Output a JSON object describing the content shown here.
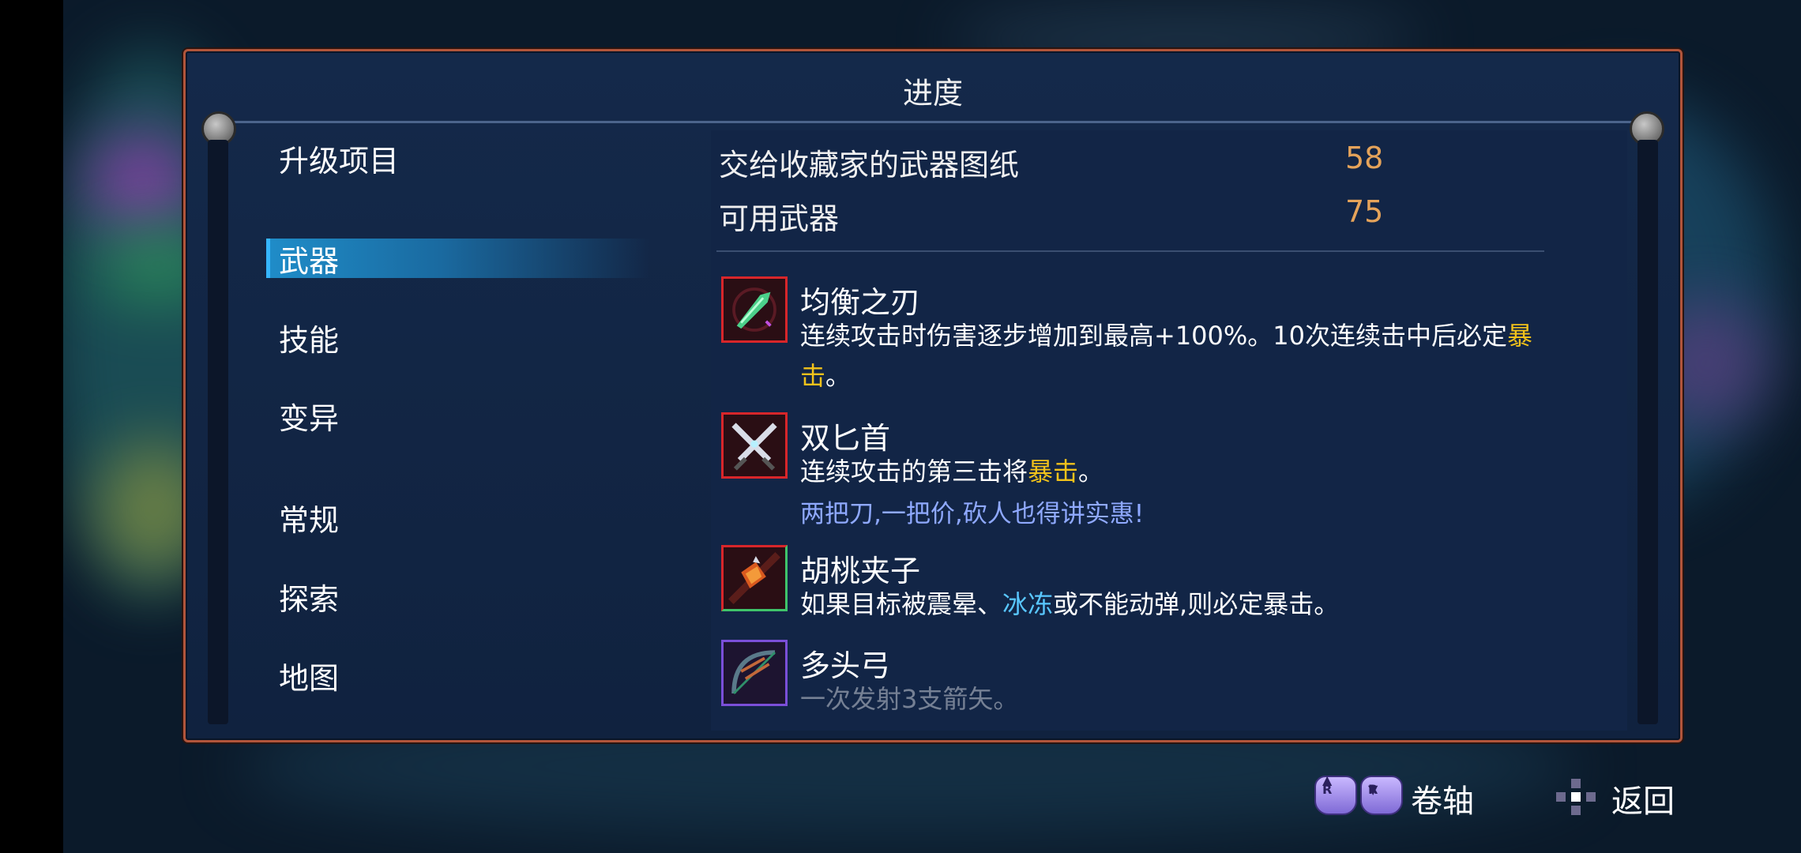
{
  "panel": {
    "title": "进度"
  },
  "menu": {
    "items": [
      {
        "label": "升级项目",
        "selected": false
      },
      {
        "label": "武器",
        "selected": true
      },
      {
        "label": "技能",
        "selected": false
      },
      {
        "label": "变异",
        "selected": false
      },
      {
        "label": "常规",
        "selected": false
      },
      {
        "label": "探索",
        "selected": false
      },
      {
        "label": "地图",
        "selected": false
      }
    ]
  },
  "stats": [
    {
      "label": "交给收藏家的武器图纸",
      "value": "58"
    },
    {
      "label": "可用武器",
      "value": "75"
    }
  ],
  "weapons": [
    {
      "name": "均衡之刃",
      "desc_part1": "连续攻击时伤害逐步增加到最高+100%。10次连续击中后必定",
      "desc_keyword": "暴击",
      "desc_part2": "。",
      "icon": "green-blade-icon"
    },
    {
      "name": "双匕首",
      "desc_part1": "连续攻击的第三击将",
      "desc_keyword": "暴击",
      "desc_part2": "。",
      "flavor": "两把刀,一把价,砍人也得讲实惠!",
      "icon": "twin-daggers-icon"
    },
    {
      "name": "胡桃夹子",
      "desc_part1": "如果目标被震晕、",
      "desc_keyword": "冰冻",
      "desc_part2": "或不能动弹,则必定暴击。",
      "icon": "nutcracker-icon"
    },
    {
      "name": "多头弓",
      "desc_part1": "一次发射3支箭矢。",
      "icon": "multi-bow-icon"
    }
  ],
  "footer": {
    "scroll_label": "卷轴",
    "back_label": "返回",
    "scroll_up_glyph": "R",
    "scroll_down_glyph": "R"
  },
  "colors": {
    "panel_border": "#b1553b",
    "crit": "#f1c21b",
    "freeze": "#59c7ff",
    "flavor": "#8fa9ff",
    "stat_value": "#e5a35a",
    "selected_highlight": "#1f8cc8"
  }
}
